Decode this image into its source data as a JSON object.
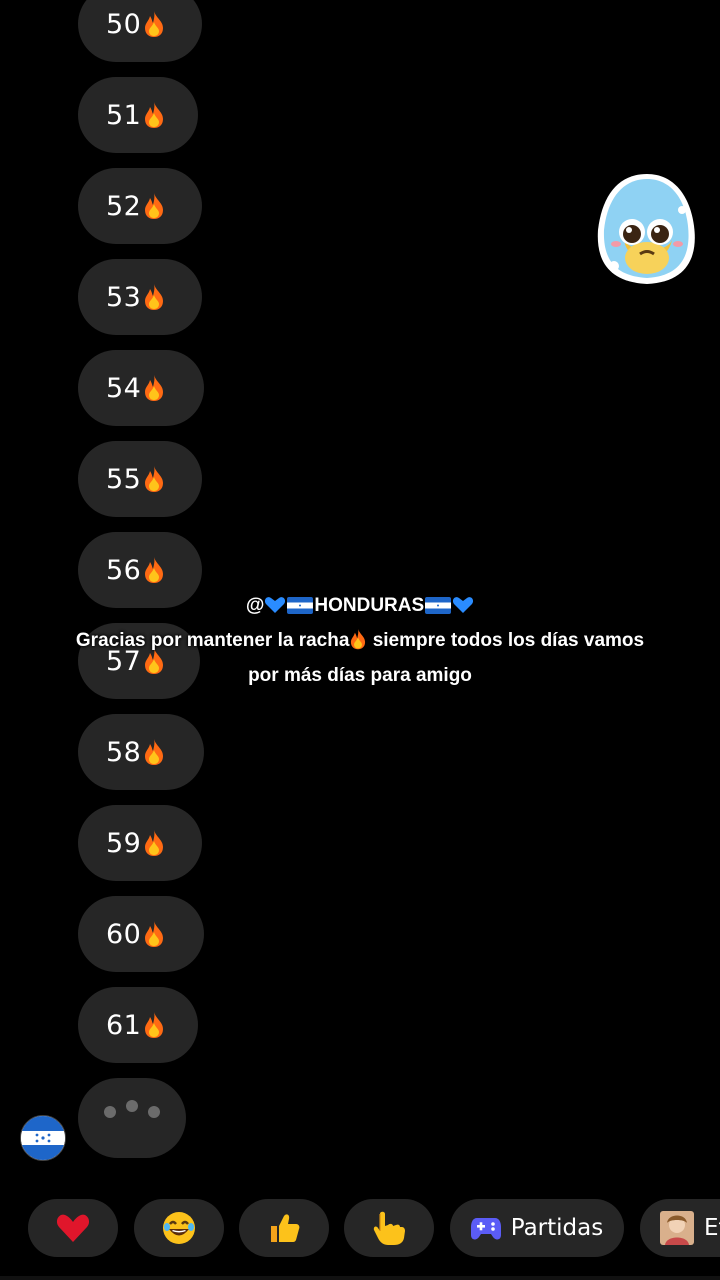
{
  "messages": [
    {
      "number": "50"
    },
    {
      "number": "51"
    },
    {
      "number": "52"
    },
    {
      "number": "53"
    },
    {
      "number": "54"
    },
    {
      "number": "55"
    },
    {
      "number": "56"
    },
    {
      "number": "57"
    },
    {
      "number": "58"
    },
    {
      "number": "59"
    },
    {
      "number": "60"
    },
    {
      "number": "61"
    }
  ],
  "overlay": {
    "mention_prefix": "@",
    "mention_name": "HONDURAS",
    "line2_a": "Gracias por mantener la racha",
    "line2_b": " siempre todos los días vamos",
    "line3": "por más días para amigo"
  },
  "reactions": [
    {
      "icon": "heart-icon"
    },
    {
      "icon": "laughing-face-icon"
    },
    {
      "icon": "thumbs-up-icon"
    },
    {
      "icon": "pointing-hand-icon"
    },
    {
      "icon": "game-controller-icon",
      "label": "Partidas"
    },
    {
      "icon": "photo-thumbnail-icon",
      "label": "Ef"
    }
  ],
  "colors": {
    "background": "#000000",
    "bubble": "#262626",
    "flag_blue": "#1e66c9",
    "heart_blue": "#2a8cff",
    "heart_red": "#e0162b",
    "controller": "#5b5cf6"
  }
}
